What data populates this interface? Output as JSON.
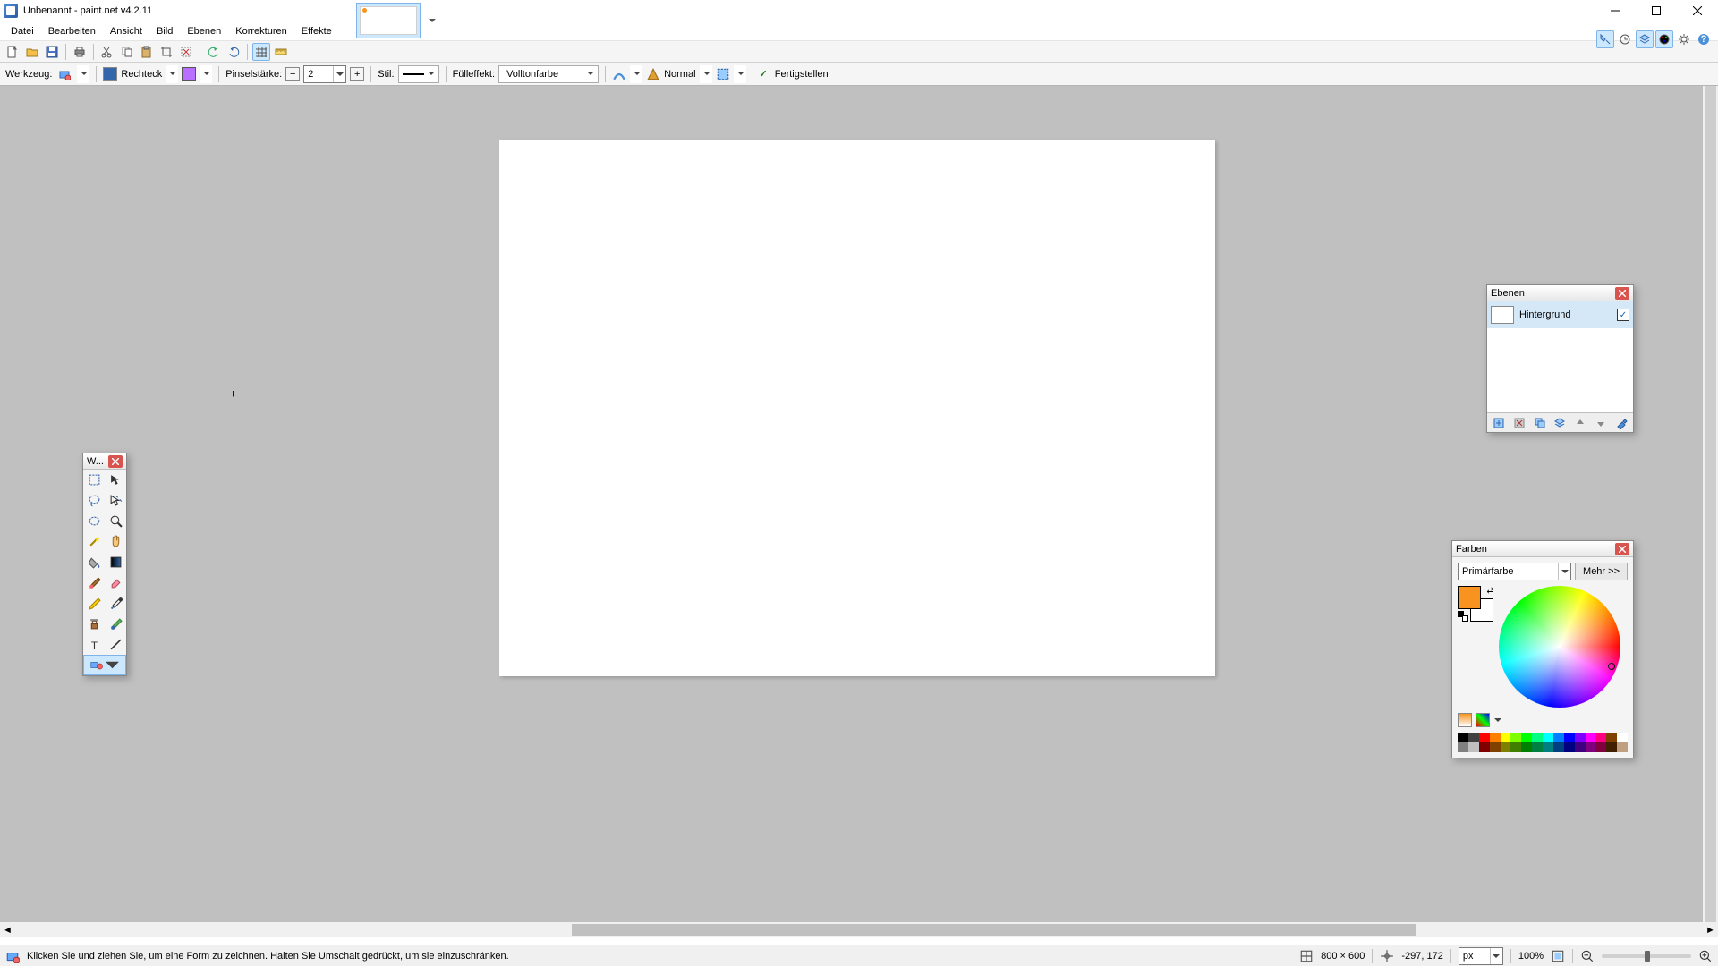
{
  "title": "Unbenannt - paint.net v4.2.11",
  "menu": [
    "Datei",
    "Bearbeiten",
    "Ansicht",
    "Bild",
    "Ebenen",
    "Korrekturen",
    "Effekte"
  ],
  "toolopts": {
    "tool_label": "Werkzeug:",
    "shape_label": "Rechteck",
    "brush_label": "Pinselstärke:",
    "brush_value": "2",
    "style_label": "Stil:",
    "fill_label": "Fülleffekt:",
    "fill_value": "Volltonfarbe",
    "blend_label": "Normal",
    "finish_label": "Fertigstellen"
  },
  "tools_panel": {
    "title": "W..."
  },
  "layers_panel": {
    "title": "Ebenen",
    "rows": [
      {
        "name": "Hintergrund",
        "visible": true
      }
    ]
  },
  "colors_panel": {
    "title": "Farben",
    "selector": "Primärfarbe",
    "more": "Mehr >>",
    "primary": "#f7931e",
    "secondary": "#ffffff"
  },
  "status": {
    "hint": "Klicken Sie und ziehen Sie, um eine Form zu zeichnen. Halten Sie Umschalt gedrückt, um sie einzuschränken.",
    "size": "800 × 600",
    "coords": "-297, 172",
    "unit": "px",
    "zoom": "100%"
  },
  "palette": {
    "row1": [
      "#000000",
      "#404040",
      "#ff0000",
      "#ff8000",
      "#ffff00",
      "#80ff00",
      "#00ff00",
      "#00ff80",
      "#00ffff",
      "#0080ff",
      "#0000ff",
      "#8000ff",
      "#ff00ff",
      "#ff0080",
      "#804000",
      "#ffffff"
    ],
    "row2": [
      "#808080",
      "#c0c0c0",
      "#800000",
      "#804000",
      "#808000",
      "#408000",
      "#008000",
      "#008040",
      "#008080",
      "#004080",
      "#000080",
      "#400080",
      "#800080",
      "#800040",
      "#402000",
      "#c0a080"
    ]
  }
}
